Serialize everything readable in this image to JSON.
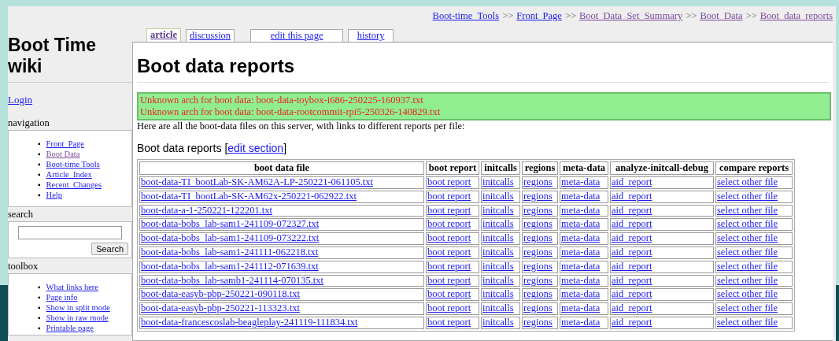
{
  "breadcrumbs": [
    {
      "label": "Boot-time_Tools",
      "visited": false
    },
    {
      "label": "Front_Page",
      "visited": false
    },
    {
      "label": "Boot_Data_Set_Summary",
      "visited": true
    },
    {
      "label": "Boot_Data",
      "visited": true
    },
    {
      "label": "Boot_data_reports",
      "visited": true
    }
  ],
  "breadcrumb_separator": ">>",
  "tabs": [
    {
      "label": "article",
      "selected": true
    },
    {
      "label": "discussion",
      "selected": false
    },
    {
      "label": "edit this page",
      "selected": false
    },
    {
      "label": "history",
      "selected": false
    }
  ],
  "sidebar": {
    "site_title": "Boot Time wiki",
    "login": "Login",
    "navigation": {
      "title": "navigation",
      "items": [
        {
          "label": "Front_Page",
          "visited": false
        },
        {
          "label": "Boot Data",
          "visited": true
        },
        {
          "label": "Boot-time Tools",
          "visited": false
        },
        {
          "label": "Article_Index",
          "visited": false
        },
        {
          "label": "Recent_Changes",
          "visited": false
        },
        {
          "label": "Help",
          "visited": false
        }
      ]
    },
    "search": {
      "title": "search",
      "button": "Search"
    },
    "toolbox": {
      "title": "toolbox",
      "items": [
        {
          "label": "What links here",
          "visited": false
        },
        {
          "label": "Page info",
          "visited": false
        },
        {
          "label": "Show in split mode",
          "visited": false
        },
        {
          "label": "Show in raw mode",
          "visited": false
        },
        {
          "label": "Printable page",
          "visited": false
        }
      ]
    }
  },
  "page_title": "Boot data reports",
  "warnings": [
    "Unknown arch for boot data: boot-data-toybox-i686-250225-160937.txt",
    "Unknown arch for boot data: boot-data-rootcommit-rpi5-250326-140829.txt"
  ],
  "intro": "Here are all the boot-data files on this server, with links to different reports per file:",
  "section": {
    "title": "Boot data reports",
    "open_bracket": "[",
    "edit_link": "edit section",
    "close_bracket": "]"
  },
  "list_bullet": "▪",
  "table": {
    "columns": [
      "boot data file",
      "boot report",
      "initcalls",
      "regions",
      "meta-data",
      "analyze-initcall-debug",
      "compare reports"
    ],
    "rows": [
      [
        "boot-data-TI_bootLab-SK-AM62A-LP-250221-061105.txt",
        "boot report",
        "initcalls",
        "regions",
        "meta-data",
        "aid_report",
        "select other file"
      ],
      [
        "boot-data-TI_bootLab-SK-AM62x-250221-062922.txt",
        "boot report",
        "initcalls",
        "regions",
        "meta-data",
        "aid_report",
        "select other file"
      ],
      [
        "boot-data-a-1-250221-122201.txt",
        "boot report",
        "initcalls",
        "regions",
        "meta-data",
        "aid_report",
        "select other file"
      ],
      [
        "boot-data-bobs_lab-sam1-241109-072327.txt",
        "boot report",
        "initcalls",
        "regions",
        "meta-data",
        "aid_report",
        "select other file"
      ],
      [
        "boot-data-bobs_lab-sam1-241109-073222.txt",
        "boot report",
        "initcalls",
        "regions",
        "meta-data",
        "aid_report",
        "select other file"
      ],
      [
        "boot-data-bobs_lab-sam1-241111-062218.txt",
        "boot report",
        "initcalls",
        "regions",
        "meta-data",
        "aid_report",
        "select other file"
      ],
      [
        "boot-data-bobs_lab-sam1-241112-071639.txt",
        "boot report",
        "initcalls",
        "regions",
        "meta-data",
        "aid_report",
        "select other file"
      ],
      [
        "boot-data-bobs_lab-samb1-241114-070135.txt",
        "boot report",
        "initcalls",
        "regions",
        "meta-data",
        "aid_report",
        "select other file"
      ],
      [
        "boot-data-easyb-pbp-250221-090118.txt",
        "boot report",
        "initcalls",
        "regions",
        "meta-data",
        "aid_report",
        "select other file"
      ],
      [
        "boot-data-easyb-pbp-250221-113323.txt",
        "boot report",
        "initcalls",
        "regions",
        "meta-data",
        "aid_report",
        "select other file"
      ],
      [
        "boot-data-francescoslab-beagleplay-241119-111834.txt",
        "boot report",
        "initcalls",
        "regions",
        "meta-data",
        "aid_report",
        "select other file"
      ]
    ]
  }
}
